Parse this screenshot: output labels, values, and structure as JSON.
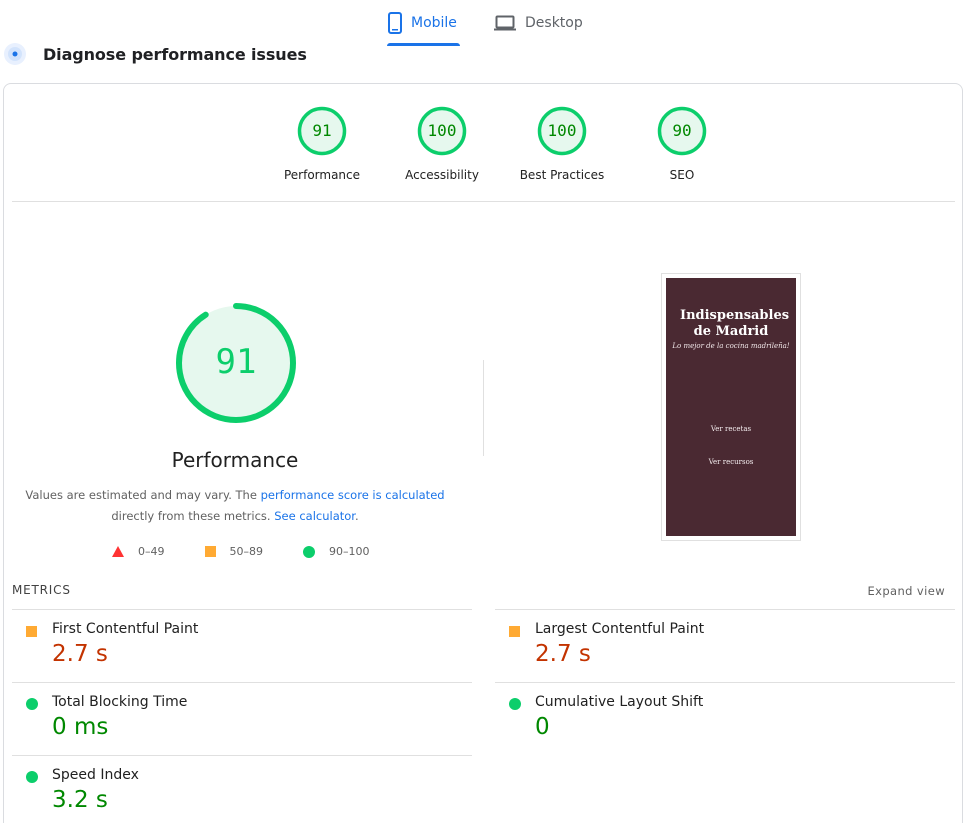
{
  "tabs": [
    {
      "label": "Mobile",
      "icon": "phone-icon",
      "active": true
    },
    {
      "label": "Desktop",
      "icon": "laptop-icon",
      "active": false
    }
  ],
  "heading": {
    "icon": "performance-target-icon",
    "title": "Diagnose performance issues"
  },
  "scores": [
    {
      "label": "Performance",
      "value": "91"
    },
    {
      "label": "Accessibility",
      "value": "100"
    },
    {
      "label": "Best Practices",
      "value": "100"
    },
    {
      "label": "SEO",
      "value": "90"
    }
  ],
  "performance": {
    "score": "91",
    "score_fraction": 0.91,
    "title": "Performance",
    "desc_prefix": "Values are estimated and may vary. The ",
    "desc_link1": "performance score is calculated",
    "desc_middle": " directly from these metrics. ",
    "desc_link2": "See calculator",
    "desc_suffix": "."
  },
  "legend": [
    {
      "range": "0–49",
      "icon": "fail-triangle"
    },
    {
      "range": "50–89",
      "icon": "average-square"
    },
    {
      "range": "90–100",
      "icon": "pass-circle"
    }
  ],
  "screenshot": {
    "title": "Indispensables de Madrid",
    "subtitle": "Lo mejor de la cocina madrileña!",
    "link1": "Ver recetas",
    "link2": "Ver recursos"
  },
  "metrics": {
    "heading": "METRICS",
    "expand_label": "Expand view",
    "items": [
      {
        "name": "First Contentful Paint",
        "value": "2.7 s",
        "status": "average"
      },
      {
        "name": "Largest Contentful Paint",
        "value": "2.7 s",
        "status": "average"
      },
      {
        "name": "Total Blocking Time",
        "value": "0 ms",
        "status": "pass"
      },
      {
        "name": "Cumulative Layout Shift",
        "value": "0",
        "status": "pass"
      },
      {
        "name": "Speed Index",
        "value": "3.2 s",
        "status": "average"
      }
    ]
  },
  "colors": {
    "accent": "#1a73e8",
    "pass": "#0cce6b",
    "pass_text": "#008800",
    "average": "#ffaa33",
    "average_text": "#c33300",
    "fail": "#ff3333",
    "thumb_bg": "#4a2932"
  }
}
